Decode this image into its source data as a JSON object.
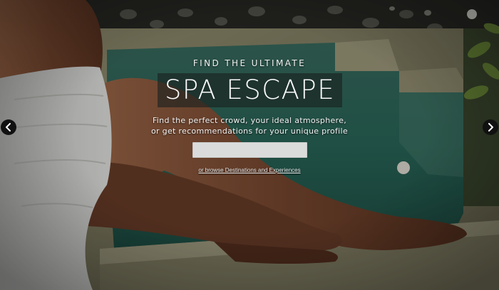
{
  "hero": {
    "eyebrow": "FIND THE ULTIMATE",
    "title": "SPA ESCAPE",
    "subtitle_line1": "Find the perfect crowd, your ideal atmosphere,",
    "subtitle_line2": "or get recommendations for your unique profile",
    "search": {
      "value": "",
      "placeholder": ""
    },
    "browse_link": "or browse Destinations and Experiences"
  },
  "carousel": {
    "prev_icon": "chevron-left-icon",
    "next_icon": "chevron-right-icon"
  },
  "colors": {
    "title_bg": "#1a201e",
    "search_bg": "#dadcdb",
    "arrow_bg": "#111111",
    "pool_water": "#2e6b5f",
    "stone": "#8d8a70",
    "skin": "#7a4a32"
  }
}
